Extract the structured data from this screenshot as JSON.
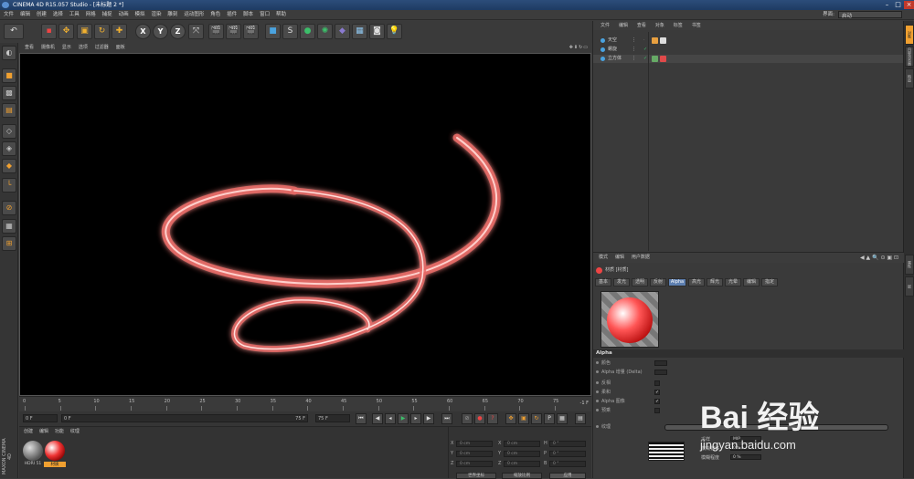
{
  "window": {
    "title": "CINEMA 4D R15.057 Studio - [未标题 2 *]"
  },
  "menu": [
    "文件",
    "编辑",
    "创建",
    "选择",
    "工具",
    "网格",
    "捕捉",
    "动画",
    "模拟",
    "渲染",
    "雕刻",
    "运动图形",
    "角色",
    "插件",
    "脚本",
    "窗口",
    "帮助"
  ],
  "layout": {
    "label": "界面:",
    "value": "启动"
  },
  "toolbar": {
    "axis_x": "X",
    "axis_y": "Y",
    "axis_z": "Z"
  },
  "viewport_menu": [
    "查看",
    "摄像机",
    "显示",
    "选项",
    "过滤器",
    "面板"
  ],
  "timeline": {
    "ticks": [
      "0",
      "5",
      "10",
      "15",
      "20",
      "25",
      "30",
      "35",
      "40",
      "45",
      "50",
      "55",
      "60",
      "65",
      "70",
      "75"
    ],
    "end_frame": "-1 F"
  },
  "transport": {
    "current": "0 F",
    "start_field": "0 F",
    "end_field": "75 F",
    "end_field2": "75 F"
  },
  "material_manager": {
    "menu": [
      "创建",
      "编辑",
      "功能",
      "纹理"
    ],
    "materials": [
      {
        "name": "HDRI 51"
      },
      {
        "name": "材质"
      }
    ]
  },
  "coordinates": {
    "rows": [
      {
        "axis": "X",
        "pos": "0 cm",
        "axis2": "X",
        "size": "0 cm",
        "axis3": "H",
        "rot": "0 °"
      },
      {
        "axis": "Y",
        "pos": "0 cm",
        "axis2": "Y",
        "size": "0 cm",
        "axis3": "P",
        "rot": "0 °"
      },
      {
        "axis": "Z",
        "pos": "0 cm",
        "axis2": "Z",
        "size": "0 cm",
        "axis3": "B",
        "rot": "0 °"
      }
    ],
    "mode_1": "世界坐标",
    "mode_2": "缩放比例",
    "apply": "应用"
  },
  "object_manager": {
    "menu": [
      "文件",
      "编辑",
      "查看",
      "对象",
      "标签",
      "书签"
    ],
    "objects": [
      {
        "name": "天空",
        "dot": "#4aa3e0",
        "tag": "#e8a040"
      },
      {
        "name": "螺旋",
        "dot": "#4aa3e0",
        "tag": ""
      },
      {
        "name": "立方体",
        "dot": "#4aa3e0",
        "tag": "#e04a4a"
      }
    ]
  },
  "right_tabs": [
    "对象",
    "内容浏览器",
    "构造",
    "属性",
    "层"
  ],
  "attribute_manager": {
    "menu": [
      "模式",
      "编辑",
      "用户数据"
    ],
    "title": "材质 [材质]",
    "tabs": [
      "基本",
      "发光",
      "透明",
      "反射",
      "Alpha",
      "高光",
      "辉光",
      "光晕",
      "编辑",
      "指定"
    ],
    "active_tab": "Alpha",
    "section": "Alpha",
    "props": [
      {
        "label": "颜色",
        "type": "box",
        "value": ""
      },
      {
        "label": "Alpha 增量 (Delta)",
        "type": "box",
        "value": ""
      },
      {
        "label": "反相",
        "type": "check",
        "value": ""
      },
      {
        "label": "柔和",
        "type": "check",
        "value": "✓"
      },
      {
        "label": "Alpha 图像",
        "type": "check",
        "value": "✓"
      },
      {
        "label": "预乘",
        "type": "check",
        "value": ""
      }
    ],
    "texture_label": "纹理",
    "texture_rows": [
      {
        "label": "采样",
        "value": "MIP"
      },
      {
        "label": "模糊偏移",
        "value": "0 %"
      },
      {
        "label": "模糊程度",
        "value": "0 %"
      }
    ]
  },
  "watermark": {
    "logo": "Bai 经验",
    "url": "jingyan.baidu.com"
  },
  "brand": "MAXON CINEMA 4D"
}
